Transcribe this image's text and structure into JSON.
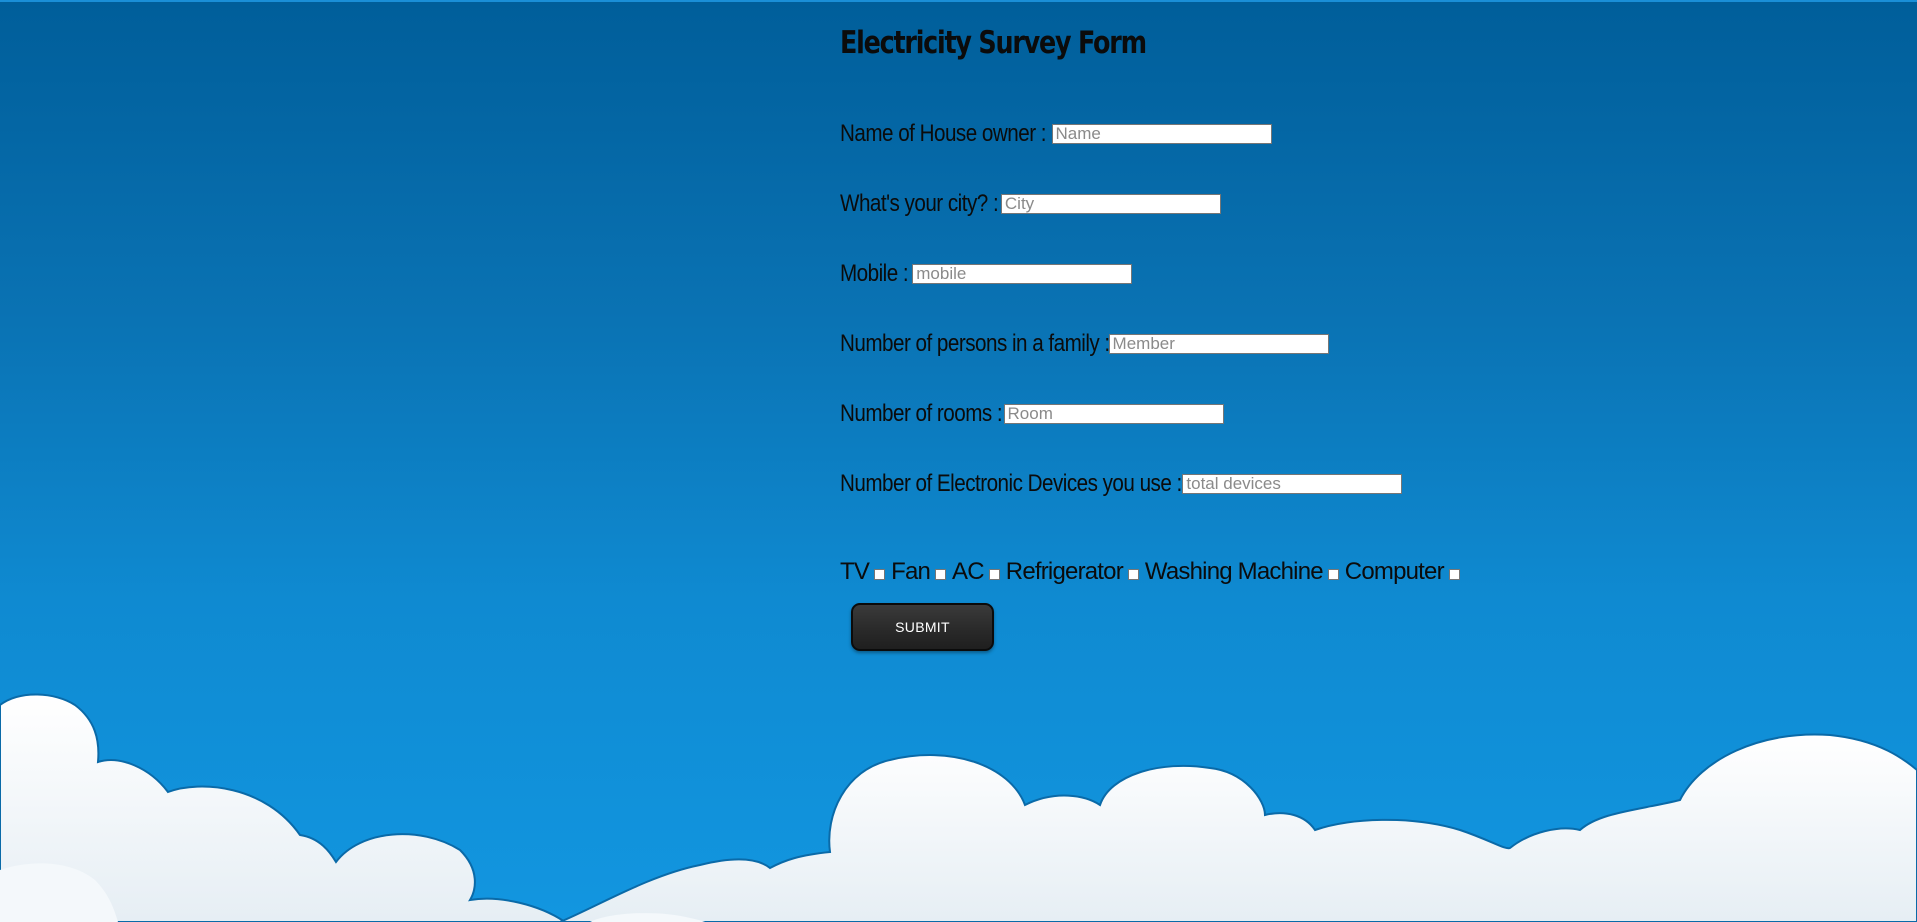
{
  "form": {
    "title": "Electricity Survey Form",
    "fields": [
      {
        "label": "Name of House owner :",
        "placeholder": "Name"
      },
      {
        "label": "What's your city? :",
        "placeholder": "City"
      },
      {
        "label": "Mobile :",
        "placeholder": "mobile"
      },
      {
        "label": "Number of persons in a family :",
        "placeholder": "Member"
      },
      {
        "label": "Number of rooms :",
        "placeholder": "Room"
      },
      {
        "label": "Number of Electronic Devices you use :",
        "placeholder": "total devices"
      }
    ],
    "devices": [
      {
        "label": "TV",
        "checked": false
      },
      {
        "label": "Fan",
        "checked": false
      },
      {
        "label": "AC",
        "checked": false
      },
      {
        "label": "Refrigerator",
        "checked": false
      },
      {
        "label": "Washing Machine",
        "checked": false
      },
      {
        "label": "Computer",
        "checked": false
      }
    ],
    "submit_label": "SUBMIT"
  },
  "colors": {
    "sky_top": "#005e9a",
    "sky_bottom": "#1296e0",
    "cloud": "#ffffff",
    "cloud_outline": "#0a6aa8",
    "button": "#2a2a2a"
  },
  "decorations": {
    "background": "sky-with-clouds"
  }
}
